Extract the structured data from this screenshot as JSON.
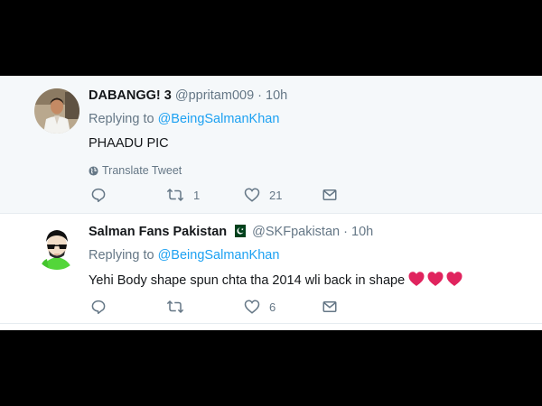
{
  "tweets": [
    {
      "display_name": "DABANGG! 3",
      "handle": "@ppritam009",
      "separator": "·",
      "time": "10h",
      "replying_prefix": "Replying to",
      "replying_to": "@BeingSalmanKhan",
      "text": "PHAADU PIC",
      "translate_label": "Translate Tweet",
      "retweets": "1",
      "likes": "21"
    },
    {
      "display_name": "Salman Fans Pakistan",
      "handle": "@SKFpakistan",
      "separator": "·",
      "time": "10h",
      "replying_prefix": "Replying to",
      "replying_to": "@BeingSalmanKhan",
      "text": "Yehi Body shape spun chta tha 2014 wli back in shape",
      "likes": "6"
    }
  ],
  "colors": {
    "link": "#1da1f2",
    "muted": "#657786",
    "text": "#14171a",
    "heart": "#e0245e",
    "highlight_bg": "#f5f8fa"
  },
  "icons": [
    "reply-icon",
    "retweet-icon",
    "like-icon",
    "message-icon",
    "globe-icon",
    "pakistan-flag-icon",
    "red-heart-icon"
  ]
}
